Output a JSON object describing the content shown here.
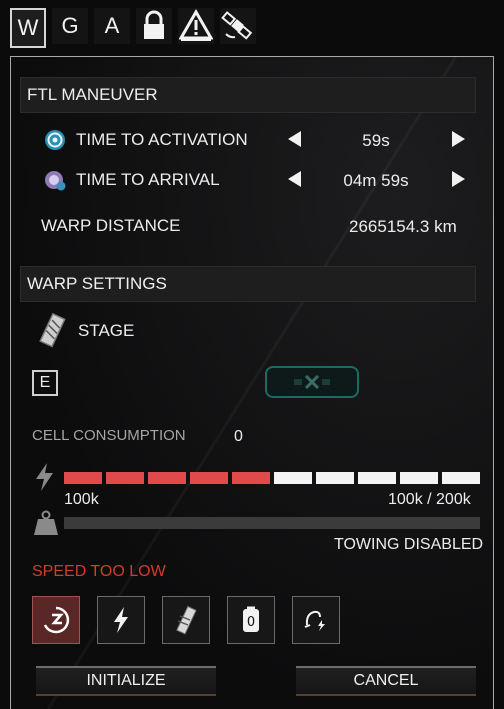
{
  "tabs": [
    {
      "label": "W",
      "active": true
    },
    {
      "label": "G"
    },
    {
      "label": "A"
    },
    {
      "icon": "lock-icon"
    },
    {
      "icon": "warning-icon"
    },
    {
      "icon": "satellite-icon"
    }
  ],
  "ftl": {
    "title": "FTL MANEUVER",
    "activation": {
      "label": "TIME TO ACTIVATION",
      "value": "59s",
      "icon": "spiral-timer-icon"
    },
    "arrival": {
      "label": "TIME TO ARRIVAL",
      "value": "04m 59s",
      "icon": "planet-timer-icon"
    },
    "distance": {
      "label": "WARP DISTANCE",
      "value": "2665154.3 km"
    }
  },
  "warp": {
    "title": "WARP SETTINGS",
    "stage_label": "STAGE",
    "stage_icon": "warp-module-icon",
    "key_hint": "E",
    "cell_label": "CELL CONSUMPTION",
    "cell_value": "0",
    "power_current": "100k",
    "power_fraction": "100k / 200k",
    "power_filled_segments": 5,
    "power_total_segments": 10,
    "towing_status": "TOWING DISABLED",
    "warning": "SPEED TOO LOW"
  },
  "colors": {
    "accent_red": "#e04a4a",
    "warning_red": "#d53a2a"
  },
  "tool_icons": [
    "speed-dial-icon",
    "lightning-icon",
    "fuel-cell-icon",
    "zero-cell-icon",
    "hand-power-icon"
  ],
  "buttons": {
    "initialize": "INITIALIZE",
    "cancel": "CANCEL"
  }
}
